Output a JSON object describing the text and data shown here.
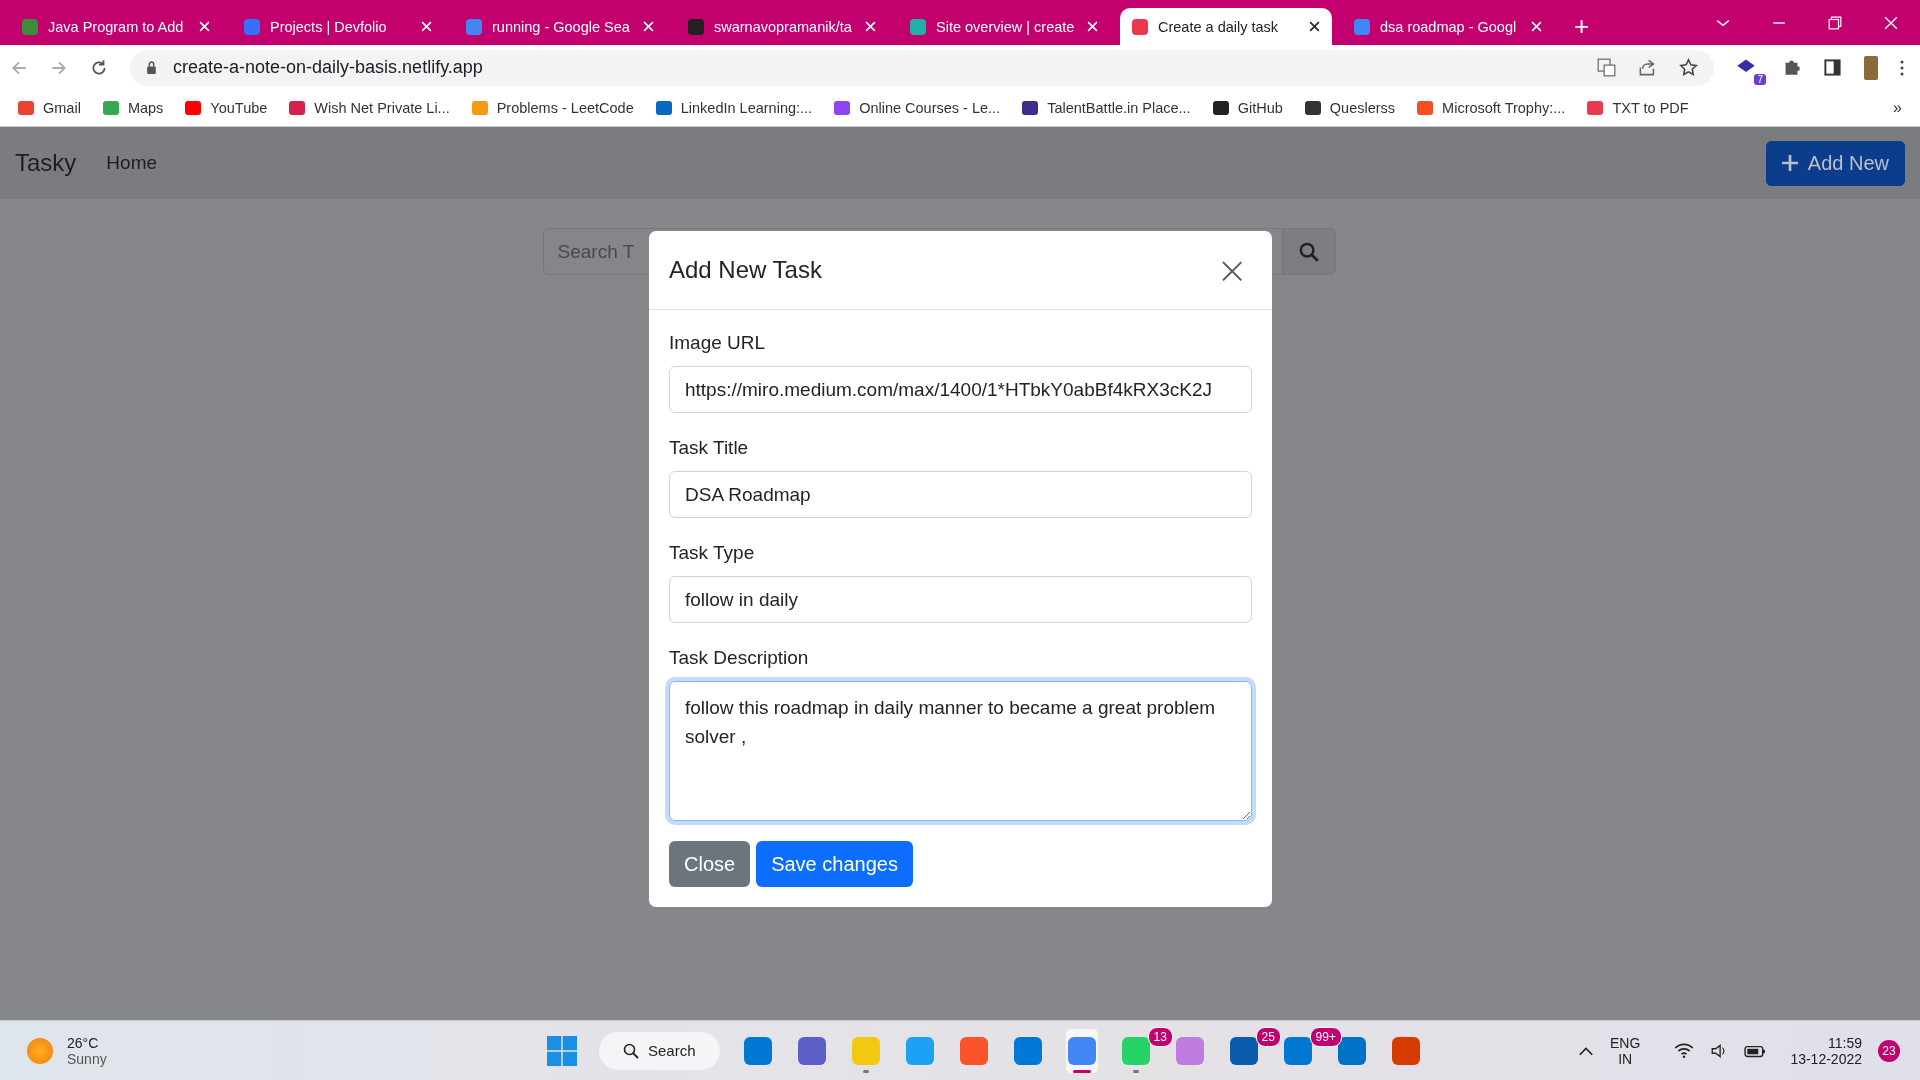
{
  "browser": {
    "tabs": [
      {
        "title": "Java Program to Add",
        "selected": false
      },
      {
        "title": "Projects | Devfolio",
        "selected": false
      },
      {
        "title": "running - Google Sea",
        "selected": false
      },
      {
        "title": "swarnavopramanik/ta",
        "selected": false
      },
      {
        "title": "Site overview | create",
        "selected": false
      },
      {
        "title": "Create a daily task",
        "selected": true
      },
      {
        "title": "dsa roadmap - Googl",
        "selected": false
      }
    ],
    "new_tab": "+",
    "address": "create-a-note-on-daily-basis.netlify.app",
    "extension_badge": "7",
    "bookmarks": [
      "Gmail",
      "Maps",
      "YouTube",
      "Wish Net Private Li...",
      "Problems - LeetCode",
      "LinkedIn Learning:...",
      "Online Courses - Le...",
      "TalentBattle.in Place...",
      "GitHub",
      "Queslerss",
      "Microsoft Trophy:...",
      "TXT to PDF"
    ],
    "bookmarks_more": "»"
  },
  "navbar": {
    "brand": "Tasky",
    "links": [
      "Home"
    ],
    "add_button": "Add New"
  },
  "search": {
    "placeholder": "Search T"
  },
  "modal": {
    "title": "Add New Task",
    "close": "×",
    "fields": [
      {
        "kind": "input",
        "label": "Image URL",
        "value": "https://miro.medium.com/max/1400/1*HTbkY0abBf4kRX3cK2J",
        "focused": false
      },
      {
        "kind": "input",
        "label": "Task Title",
        "value": "DSA Roadmap",
        "focused": false
      },
      {
        "kind": "input",
        "label": "Task Type",
        "value": "follow in daily",
        "focused": false
      },
      {
        "kind": "textarea",
        "label": "Task Description",
        "value": "follow this roadmap in daily manner to became a great problem solver ,",
        "focused": true
      }
    ],
    "buttons": [
      {
        "kind": "secondary",
        "label": "Close"
      },
      {
        "kind": "primary",
        "label": "Save changes"
      }
    ]
  },
  "taskbar": {
    "weather": {
      "temp": "26°C",
      "condition": "Sunny"
    },
    "search": "Search",
    "apps": [
      {
        "running": false,
        "selected": false
      },
      {
        "running": false,
        "selected": false
      },
      {
        "running": true,
        "selected": false
      },
      {
        "running": false,
        "selected": false
      },
      {
        "running": false,
        "selected": false
      },
      {
        "running": false,
        "selected": false
      },
      {
        "running": true,
        "selected": true
      },
      {
        "badge": "13",
        "running": true,
        "selected": false
      },
      {
        "running": false,
        "selected": false
      },
      {
        "badge": "25",
        "running": false,
        "selected": false
      },
      {
        "badge": "99+",
        "running": false,
        "selected": false
      },
      {
        "running": false,
        "selected": false
      },
      {
        "running": false,
        "selected": false
      }
    ],
    "language": "ENG",
    "region": "IN",
    "time": "11:59",
    "date": "13-12-2022",
    "notifications": "23"
  }
}
